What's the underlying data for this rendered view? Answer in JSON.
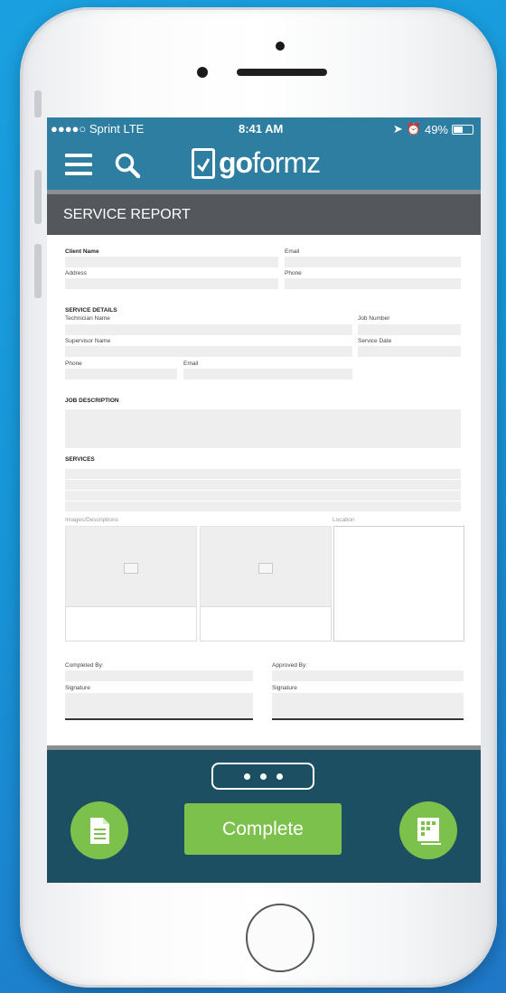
{
  "status_bar": {
    "carrier": "●●●●○ Sprint  LTE",
    "time": "8:41 AM",
    "battery": "49%",
    "battery_level": 0.49
  },
  "app": {
    "logo_bold": "go",
    "logo_rest": "formz"
  },
  "form": {
    "title": "SERVICE REPORT",
    "client_name_label": "Client Name",
    "email_label": "Email",
    "address_label": "Address",
    "phone_label": "Phone",
    "service_details_heading": "SERVICE DETAILS",
    "technician_name_label": "Technician Name",
    "job_number_label": "Job Number",
    "supervisor_name_label": "Supervisor Name",
    "service_date_label": "Service Date",
    "phone2_label": "Phone",
    "email2_label": "Email",
    "job_description_heading": "JOB DESCRIPTION",
    "services_heading": "SERVICES",
    "images_label": "Images/Descriptions",
    "location_label": "Location",
    "completed_by_label": "Completed By:",
    "approved_by_label": "Approved By:",
    "signature_label": "Signature",
    "signature2_label": "Signature"
  },
  "bottom_bar": {
    "complete_label": "Complete"
  },
  "colors": {
    "nav": "#2d7ea1",
    "bottom": "#1d4f63",
    "accent_green": "#7cc14b",
    "form_header": "#54585d"
  },
  "icons": [
    "menu-icon",
    "search-icon",
    "goformz-logo-icon",
    "more-dots-icon",
    "document-icon",
    "grid-form-icon"
  ]
}
